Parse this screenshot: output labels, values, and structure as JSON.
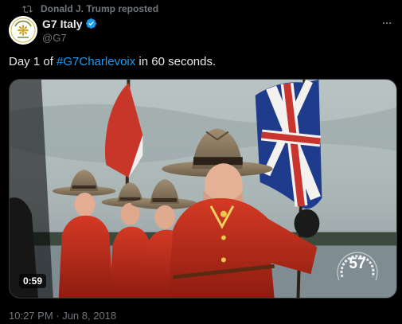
{
  "repost": {
    "icon": "repost-icon",
    "label": "Donald J. Trump reposted"
  },
  "author": {
    "avatar_icon": "g7-italy-logo",
    "display_name": "G7 Italy",
    "verified_icon": "verified-badge-icon",
    "handle": "@G7"
  },
  "menu": {
    "icon": "more-options-icon"
  },
  "tweet": {
    "text_before": "Day 1 of ",
    "hashtag": "#G7Charlevoix",
    "text_after": " in 60 seconds."
  },
  "video": {
    "duration": "0:59",
    "overlay_number": "57"
  },
  "meta": {
    "timestamp": "10:27 PM · Jun 8, 2018"
  },
  "colors": {
    "background": "#000000",
    "text": "#e7e9ea",
    "muted": "#71767b",
    "accent": "#1d9bf0"
  }
}
